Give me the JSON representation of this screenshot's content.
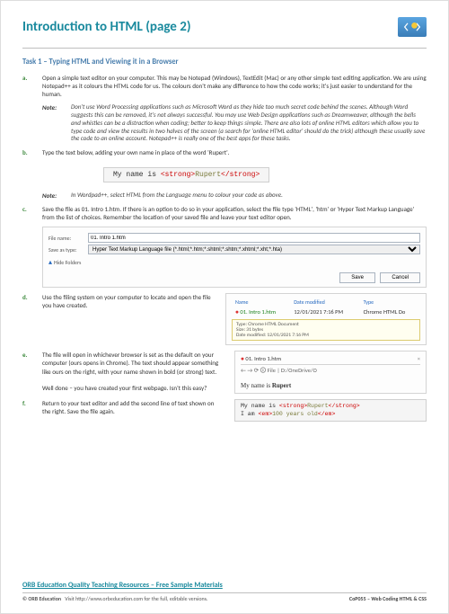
{
  "header": {
    "title": "Introduction to HTML (page 2)"
  },
  "task": {
    "heading": "Task 1 – Typing HTML and Viewing it in a Browser"
  },
  "items": {
    "a": {
      "letter": "a.",
      "text": "Open a simple text editor on your computer.  This may be Notepad (Windows), TextEdit (Mac) or any other simple text editing application.  We are using Notepad++ as it colours the HTML code for us.  The colours don't make any difference to how the code works; it's just easier to understand for the human."
    },
    "note1": {
      "label": "Note:",
      "text": "Don't use Word Processing applications such as Microsoft Word as they hide too much secret code behind the scenes.  Although Word suggests this can be removed, it's not always successful.  You may use Web Design applications such as Dreamweaver, although the bells and whistles can be a distraction when coding; better to keep things simple.  There are also lots of online HTML editors which allow you to type code and view the results in two halves of the screen (a search for 'online HTML editor' should do the trick) although these usually save the code to an online account.  Notepad++ is really one of the best apps for these tasks."
    },
    "b": {
      "letter": "b.",
      "text": "Type the text below, adding your own name in place of the word 'Rupert'."
    },
    "code": {
      "pre": "My name is ",
      "open": "<strong>",
      "name": "Rupert",
      "close": "</strong>"
    },
    "note2": {
      "label": "Note:",
      "text": "In Wordpad++, select HTML from the Language menu to colour your code as above."
    },
    "c": {
      "letter": "c.",
      "text": "Save the file as 01. Intro 1.htm.  If there is an option to do so in your application, select the file type 'HTML', 'htm' or 'Hyper Text Markup Language' from the list of choices.  Remember the location of your saved file and leave your text editor open."
    },
    "d": {
      "letter": "d.",
      "text": "Use the filing system on your computer to locate and open the file you have created."
    },
    "e": {
      "letter": "e.",
      "text": "The file will open in whichever browser is set as the default on your computer (ours opens in Chrome).  The text should appear something like ours on the right, with your name shown in bold (or strong) text.",
      "text2": "Well done – you have created your first webpage.  Isn't this easy?"
    },
    "f": {
      "letter": "f.",
      "text": "Return to your text editor and add the second line of text shown on the right.  Save the file again."
    }
  },
  "figA": {
    "filename_label": "File name:",
    "filename_value": "01. Intro 1.htm",
    "saveas_label": "Save as type:",
    "saveas_value": "Hyper Text Markup Language file (*.html;*.htm;*.shtml;*.shtm;*.xhtml;*.xht;*.hta)",
    "hide": "Hide Folders",
    "save": "Save",
    "cancel": "Cancel"
  },
  "figD": {
    "col1": "Name",
    "col2": "Date modified",
    "col3": "Type",
    "filename": "01. Intro 1.htm",
    "date": "12/01/2021 7:16 PM",
    "type": "Chrome HTML Do",
    "tip1": "Type: Chrome HTML Document",
    "tip2": "Size: 31 bytes",
    "tip3": "Date modified: 12/01/2021 7:16 PM"
  },
  "figE": {
    "tab": "01. Intro 1.htm",
    "addr_prefix": "File",
    "addr": "D:/OneDrive/O",
    "line1": "My name is ",
    "line1b": "Rupert"
  },
  "figF": {
    "l1a": "My name is ",
    "l1b": "<strong>",
    "l1c": "Rupert",
    "l1d": "</strong>",
    "l2a": "I am ",
    "l2b": "<em>",
    "l2c": "100 years old",
    "l2d": "</em>"
  },
  "footer": {
    "head": "ORB Education Quality Teaching Resources – Free Sample Materials",
    "left": "© ORB Education",
    "mid": "Visit http://www.orbeducation.com for the full, editable versions.",
    "right": "CoP055 – Web Coding HTML & CSS"
  }
}
